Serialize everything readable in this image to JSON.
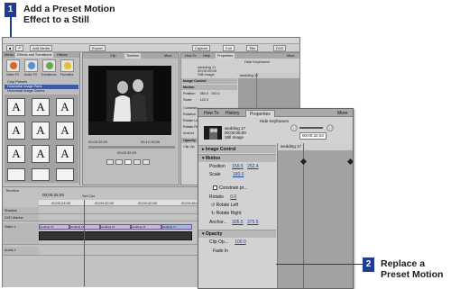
{
  "callouts": {
    "step1": {
      "number": "1",
      "line1": "Add a Preset Motion",
      "line2": "Effect to a Still"
    },
    "step2": {
      "number": "2",
      "line1": "Replace a",
      "line2": "Preset Motion"
    }
  },
  "menu": {
    "items": [
      "File",
      "Edit",
      "Project",
      "Clip",
      "Timeline",
      "Marker",
      "Title",
      "Window",
      "Help"
    ]
  },
  "toolbar": {
    "add_media": "Add Media",
    "export": "Export",
    "capture": "Capture",
    "edit": "Edit",
    "title": "Title",
    "dvd": "DVD"
  },
  "left_panel": {
    "tabs": [
      "Media",
      "Effects and Transitions",
      "History"
    ],
    "more": "More",
    "icons": [
      "Video FX",
      "Audio FX",
      "Transitions",
      "Favorites"
    ],
    "list": [
      "Crop Presets",
      "Horizontal Image Pans",
      "Horizontal Image Zooms"
    ],
    "thumb_glyph": "A"
  },
  "monitor": {
    "tabs": [
      "Clip",
      "Timeline"
    ],
    "more": "More",
    "timecode_left": "00;00;32;03",
    "timecode_right": "00;12;16;06",
    "timecode_current": "00;00;32;03"
  },
  "effect_back": {
    "tabs": [
      "How To",
      "Help",
      "Properties"
    ],
    "more": "More",
    "heading": "Hide Keyframes",
    "clip_name": "wedding 17",
    "clip_time": "00;00;05;00",
    "clip_type": "Still Image",
    "grid_clip": "wedding 17",
    "rows": [
      "Image Control",
      "Motion",
      "Position",
      "Scale",
      "Constrain",
      "Rotation",
      "Rotate Left",
      "Rotate Right",
      "Anchor",
      "Opacity",
      "Clip Op"
    ],
    "position_x": "360.0",
    "position_y": "240.0",
    "scale": "120.0",
    "rotation": "0.0"
  },
  "timeline": {
    "tab": "Timeline",
    "timecode": "00;00;32;03",
    "set_cue": "Set Cue",
    "ruler_marks": [
      "00;00;24;00",
      "00;00;32;00",
      "00;00;40;00",
      "00;00;48;00",
      "00;00;56;00",
      "00;01;04;00"
    ],
    "track_labels": [
      "Shadow",
      "DVD Marker",
      "Video 1",
      "Audio 1"
    ],
    "clip_labels": [
      "wedding 13",
      "wedding 14",
      "wedding 15",
      "wedding 16",
      "wedding 17"
    ]
  },
  "effect_front": {
    "tabs": [
      "How To",
      "History",
      "Properties"
    ],
    "more": "More",
    "heading": "Hide Keyframes",
    "clip_name": "wedding 17",
    "clip_time": "00;00;05;00",
    "clip_type": "Still Image",
    "timecode": "00;00;32;03",
    "grid_clip": "wedding 17",
    "rows": {
      "image_control": "Image Control",
      "motion": "Motion",
      "position": "Position",
      "position_x": "159.5",
      "position_y": "252.4",
      "scale": "Scale",
      "scale_val": "190.0",
      "constrain": "Constrain pr...",
      "rotation": "Rotatio",
      "rotation_val": "0.0",
      "rotate_left": "Rotate Left",
      "rotate_right": "Rotate Right",
      "anchor": "Anchor...",
      "anchor_x": "305.5",
      "anchor_y": "375.5",
      "opacity": "Opacity",
      "clip_op": "Clip Op...",
      "clip_op_val": "100.0",
      "fade_in": "Fade In"
    }
  }
}
